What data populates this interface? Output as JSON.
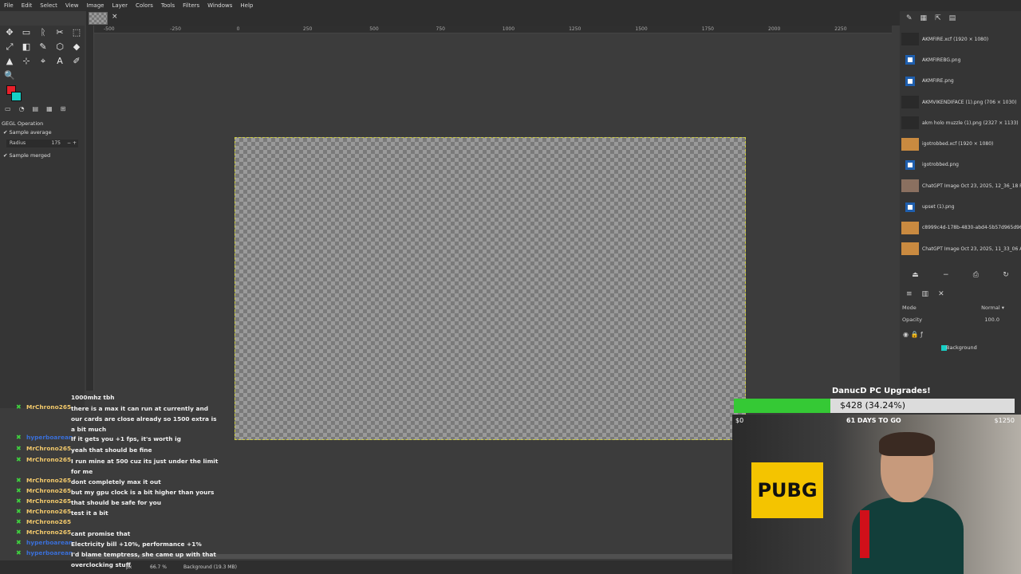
{
  "menu": [
    "File",
    "Edit",
    "Select",
    "View",
    "Image",
    "Layer",
    "Colors",
    "Tools",
    "Filters",
    "Windows",
    "Help"
  ],
  "tab_close": "×",
  "toolbox": {
    "tools": [
      "✥",
      "▭",
      "ᚱ",
      "✂",
      "⬚",
      "⤢",
      "◧",
      "✎",
      "⬡",
      "◆",
      "▲",
      "⊹",
      "⌖",
      "A",
      "✐",
      "🔍"
    ],
    "option_tabs": [
      "▭",
      "◔",
      "▤",
      "▦",
      "⊞"
    ],
    "gegl": "GEGL Operation",
    "sample_average": "Sample average",
    "radius_label": "Radius",
    "radius_value": "175",
    "radius_buttons": "− +",
    "sample_merged": "Sample merged",
    "fg_color": "#e8202a",
    "bg_color": "#17d0c6"
  },
  "ruler_ticks": [
    "-500",
    "-250",
    "0",
    "250",
    "500",
    "750",
    "1000",
    "1250",
    "1500",
    "1750",
    "2000",
    "2250"
  ],
  "status": {
    "unit": "px",
    "zoom": "66.7 %",
    "layer_info": "Background (19.3 MB)"
  },
  "images": [
    {
      "name": "AKMFIRE.xcf (1920 × 1080)",
      "thumb": "dark"
    },
    {
      "name": "AKMFIREBG.png",
      "thumb": "doc"
    },
    {
      "name": "AKMFIRE.png",
      "thumb": "doc"
    },
    {
      "name": "AKMVIKENDIFACE (1).png (706 × 1030)",
      "thumb": "dark"
    },
    {
      "name": "akm holo muzzle (1).png (2327 × 1133)",
      "thumb": "dark"
    },
    {
      "name": "igotrobbed.xcf (1920 × 1080)",
      "thumb": "sand"
    },
    {
      "name": "igotrobbed.png",
      "thumb": "doc"
    },
    {
      "name": "ChatGPT Image Oct 23, 2025, 12_36_18 PM",
      "thumb": "face"
    },
    {
      "name": "upset (1).png",
      "thumb": "doc"
    },
    {
      "name": "c8999c4d-178b-4830-abd4-5b57d965d963",
      "thumb": "sand"
    },
    {
      "name": "ChatGPT Image Oct 23, 2025, 11_33_06 AM",
      "thumb": "sand"
    }
  ],
  "layers": {
    "mode_label": "Mode",
    "mode_value": "Normal ▾",
    "opacity_label": "Opacity",
    "opacity_value": "100.0",
    "layer_name": "Background"
  },
  "chat": [
    {
      "user": "",
      "msg": "1000mhz tbh",
      "color": "#f2c96b"
    },
    {
      "user": "MrChrono265",
      "msg": "there is a max it can run at currently and our cards are close already so 1500 extra is a bit much",
      "color": "#f2c96b"
    },
    {
      "user": "hyperboarean",
      "msg": "If it gets you +1 fps, it's worth ig",
      "color": "#3a6fd8"
    },
    {
      "user": "MrChrono265",
      "msg": "yeah that should be fine",
      "color": "#f2c96b"
    },
    {
      "user": "MrChrono265",
      "msg": "I run mine at 500 cuz its just under the limit for me",
      "color": "#f2c96b"
    },
    {
      "user": "MrChrono265",
      "msg": "dont completely max it out",
      "color": "#f2c96b"
    },
    {
      "user": "MrChrono265",
      "msg": "but my gpu clock is a bit higher than yours",
      "color": "#f2c96b"
    },
    {
      "user": "MrChrono265",
      "msg": "that should be safe for you",
      "color": "#f2c96b"
    },
    {
      "user": "MrChrono265",
      "msg": "test it a bit",
      "color": "#f2c96b"
    },
    {
      "user": "MrChrono265",
      "msg": "",
      "color": "#f2c96b"
    },
    {
      "user": "MrChrono265",
      "msg": "cant promise that",
      "color": "#f2c96b"
    },
    {
      "user": "hyperboarean",
      "msg": "Electricity bill +10%, performance +1%",
      "color": "#3a6fd8"
    },
    {
      "user": "hyperboarean",
      "msg": "I'd blame temptress, she came up with that overclocking stuff",
      "color": "#3a6fd8"
    }
  ],
  "goal": {
    "title": "DanucD PC Upgrades!",
    "amount": "$428 (34.24%)",
    "progress": 0.3424,
    "min": "$0",
    "max": "$1250",
    "days": "61 DAYS TO GO",
    "poster": "PUBG"
  }
}
